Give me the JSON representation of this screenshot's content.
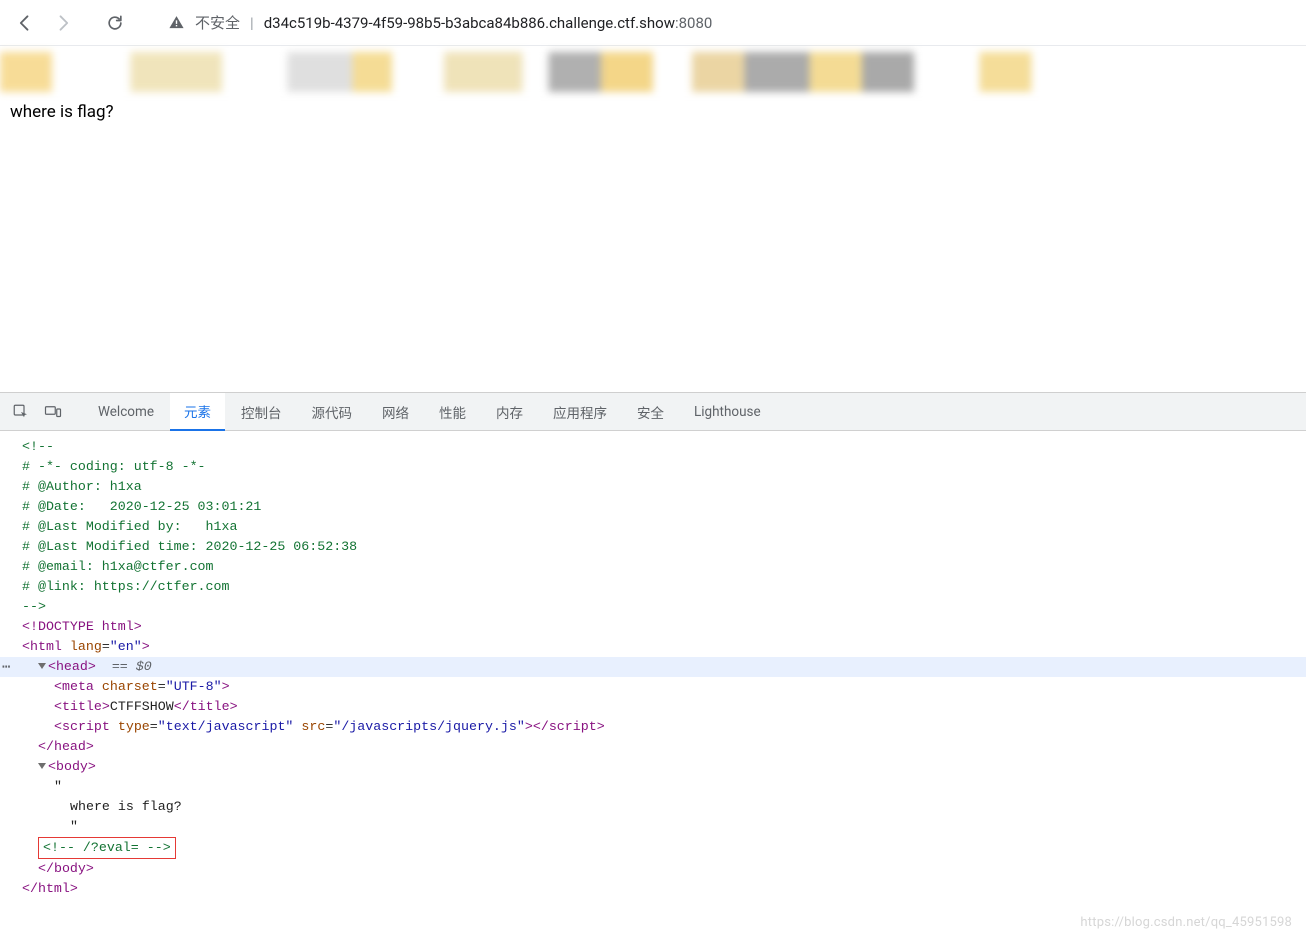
{
  "toolbar": {
    "not_secure": "不安全",
    "host": "d34c519b-4379-4f59-98b5-b3abca84b886.challenge.ctf.show",
    "port": ":8080",
    "sep": "|"
  },
  "page": {
    "heading": "where is flag?"
  },
  "devtools": {
    "tabs": {
      "welcome": "Welcome",
      "elements": "元素",
      "console": "控制台",
      "sources": "源代码",
      "network": "网络",
      "performance": "性能",
      "memory": "内存",
      "application": "应用程序",
      "security": "安全",
      "lighthouse": "Lighthouse"
    },
    "comment_lines": [
      "<!--",
      "# -*- coding: utf-8 -*-",
      "# @Author: h1xa",
      "# @Date:   2020-12-25 03:01:21",
      "# @Last Modified by:   h1xa",
      "# @Last Modified time: 2020-12-25 06:52:38",
      "# @email: h1xa@ctfer.com",
      "# @link: https://ctfer.com",
      "",
      "-->"
    ],
    "doctype": "<!DOCTYPE html>",
    "html_tag": "html",
    "html_lang_attr": "lang",
    "html_lang_val": "\"en\"",
    "head_tag": "head",
    "sel_marker": "== $0",
    "meta_tag": "meta",
    "meta_attr": "charset",
    "meta_val": "\"UTF-8\"",
    "title_tag": "title",
    "title_text": "CTFFSHOW",
    "script_tag": "script",
    "script_type_attr": "type",
    "script_type_val": "\"text/javascript\"",
    "script_src_attr": "src",
    "script_src_val": "\"/javascripts/jquery.js\"",
    "head_close": "head",
    "body_tag": "body",
    "body_text_q1": "\"",
    "body_text_where": "where is flag?",
    "body_text_q2": "\"",
    "hidden_comment": "<!-- /?eval= -->",
    "body_close": "body",
    "html_close": "html"
  },
  "watermark": "https://blog.csdn.net/qq_45951598"
}
